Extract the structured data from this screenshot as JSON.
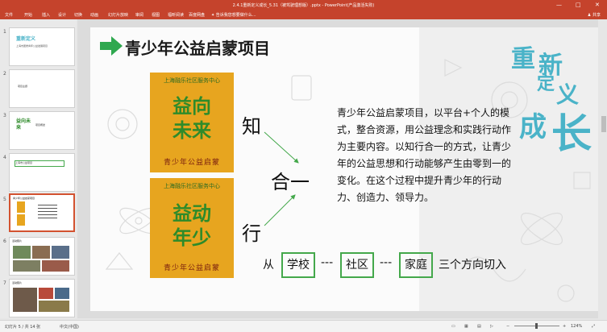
{
  "window": {
    "title": "2.4.1重新定义成长_5.31（被驾驶理想版）.pptx - PowerPoint(产品激活失败)",
    "controls": [
      "—",
      "□",
      "✕"
    ]
  },
  "ribbon": {
    "tabs": [
      "文件",
      "开始",
      "插入",
      "设计",
      "切换",
      "动画",
      "幻灯片放映",
      "审阅",
      "视图",
      "福昕阅读",
      "百度网盘"
    ],
    "tell_me": "告诉我您想要做什么...",
    "share": "共享"
  },
  "thumbnails": [
    {
      "num": "1",
      "line1": "重新定义",
      "line2": "上海市团委青年公益发展项目"
    },
    {
      "num": "2",
      "line1": "项目主题",
      "line2": ""
    },
    {
      "num": "3",
      "line1": "益向未来",
      "line2": "项目概述"
    },
    {
      "num": "4",
      "line1": "上海市公益项目",
      "line2": ""
    },
    {
      "num": "5",
      "line1": "青少年公益启蒙项目",
      "line2": ""
    },
    {
      "num": "6",
      "line1": "活动照片",
      "line2": ""
    },
    {
      "num": "7",
      "line1": "活动照片",
      "line2": ""
    }
  ],
  "slide": {
    "heading": "青少年公益启蒙项目",
    "logo_top": {
      "org": "上海融乐社区服务中心",
      "line1": "益向",
      "line2": "未来",
      "tagline": "青少年公益启蒙"
    },
    "logo_bottom": {
      "org": "上海融乐社区服务中心",
      "line1": "益动",
      "line2": "年少",
      "tagline": "青少年公益启蒙"
    },
    "zhi": "知",
    "xing": "行",
    "heyi": "合一",
    "paragraph": "青少年公益启蒙项目，以平台+个人的模式，整合资源，用公益理念和实践行动作为主要内容。以知行合一的方式，让青少年的公益思想和行动能够产生由零到一的变化。在这个过程中提升青少年的行动力、创造力、领导力。",
    "from": "从",
    "school": "学校",
    "sep1": "---",
    "community": "社区",
    "sep2": "---",
    "family": "家庭",
    "tail": "三个方向切入",
    "decor_chars": [
      "重",
      "新",
      "定",
      "义",
      "成",
      "长"
    ]
  },
  "status": {
    "slide_info": "幻灯片 5 / 共 14 张",
    "language": "中文(中国)",
    "zoom": "124%"
  },
  "colors": {
    "titlebar": "#c5432c",
    "green": "#44a84b",
    "logo_bg": "#e7a51f",
    "accent_teal": "#4ab3c8"
  }
}
